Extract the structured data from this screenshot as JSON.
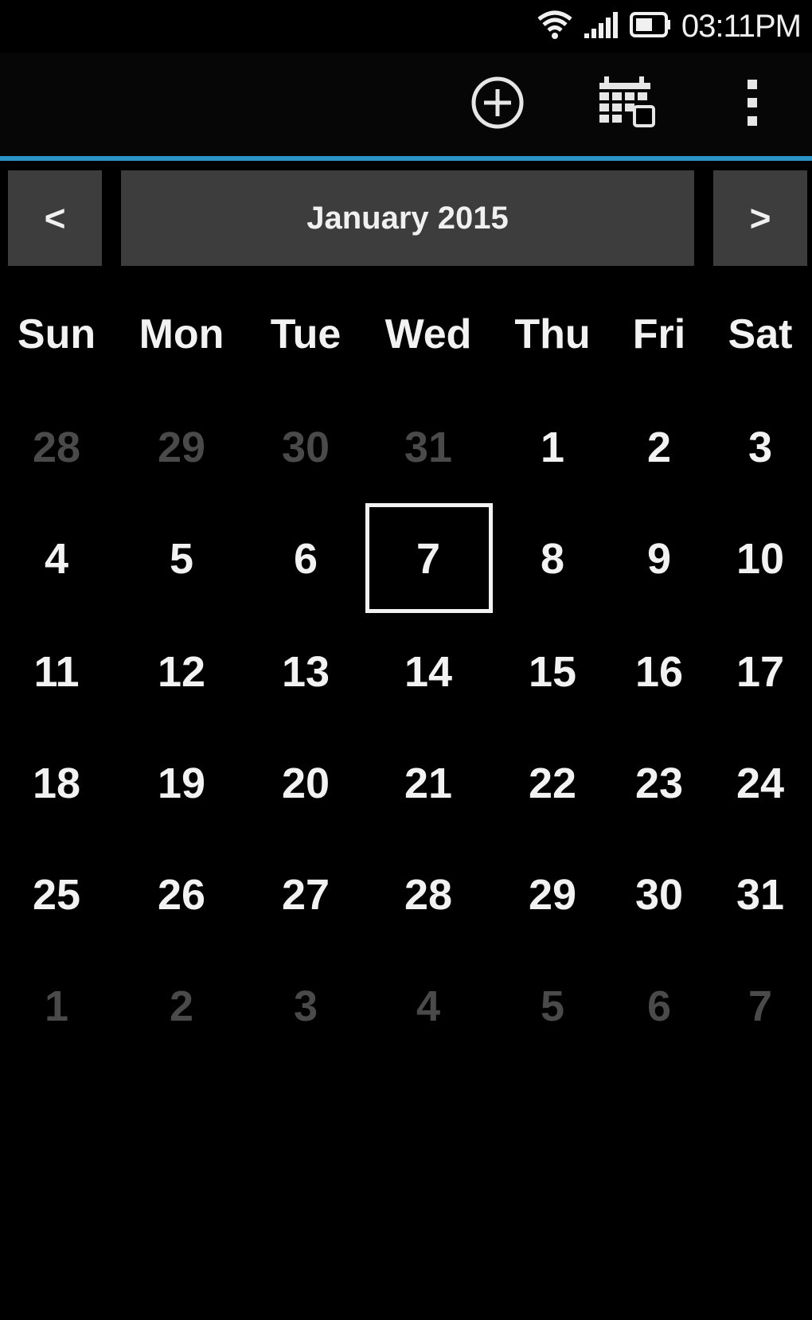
{
  "status_bar": {
    "time": "03:11PM",
    "icons": [
      "wifi-icon",
      "signal-icon",
      "battery-icon"
    ]
  },
  "action_bar": {
    "actions": [
      "add-icon",
      "calendar-view-icon",
      "overflow-menu-icon"
    ]
  },
  "month_nav": {
    "prev_label": "<",
    "title": "January 2015",
    "next_label": ">"
  },
  "weekdays": [
    "Sun",
    "Mon",
    "Tue",
    "Wed",
    "Thu",
    "Fri",
    "Sat"
  ],
  "weeks": [
    [
      {
        "d": "28",
        "m": true
      },
      {
        "d": "29",
        "m": true
      },
      {
        "d": "30",
        "m": true
      },
      {
        "d": "31",
        "m": true
      },
      {
        "d": "1"
      },
      {
        "d": "2"
      },
      {
        "d": "3"
      }
    ],
    [
      {
        "d": "4"
      },
      {
        "d": "5"
      },
      {
        "d": "6"
      },
      {
        "d": "7",
        "today": true
      },
      {
        "d": "8"
      },
      {
        "d": "9"
      },
      {
        "d": "10"
      }
    ],
    [
      {
        "d": "11"
      },
      {
        "d": "12"
      },
      {
        "d": "13"
      },
      {
        "d": "14"
      },
      {
        "d": "15"
      },
      {
        "d": "16"
      },
      {
        "d": "17"
      }
    ],
    [
      {
        "d": "18"
      },
      {
        "d": "19"
      },
      {
        "d": "20"
      },
      {
        "d": "21"
      },
      {
        "d": "22"
      },
      {
        "d": "23"
      },
      {
        "d": "24"
      }
    ],
    [
      {
        "d": "25"
      },
      {
        "d": "26"
      },
      {
        "d": "27"
      },
      {
        "d": "28"
      },
      {
        "d": "29"
      },
      {
        "d": "30"
      },
      {
        "d": "31"
      }
    ],
    [
      {
        "d": "1",
        "m": true
      },
      {
        "d": "2",
        "m": true
      },
      {
        "d": "3",
        "m": true
      },
      {
        "d": "4",
        "m": true
      },
      {
        "d": "5",
        "m": true
      },
      {
        "d": "6",
        "m": true
      },
      {
        "d": "7",
        "m": true
      }
    ]
  ],
  "colors": {
    "accent": "#2a93c3",
    "nav_background": "#3d3d3d",
    "muted_day": "#4a4a4a",
    "text": "#f2f2f2"
  }
}
